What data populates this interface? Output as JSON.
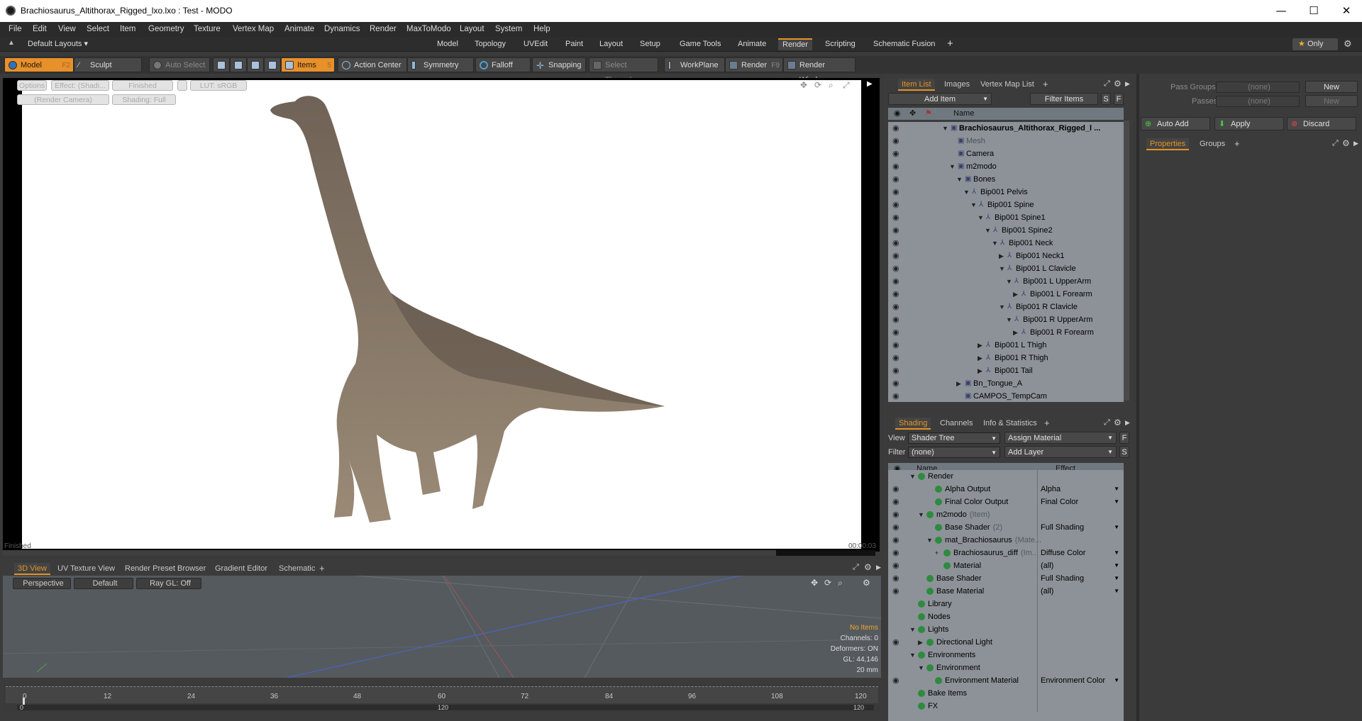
{
  "window": {
    "title": "Brachiosaurus_Altithorax_Rigged_lxo.lxo : Test - MODO",
    "minimize": "—",
    "maximize": "☐",
    "close": "✕"
  },
  "menu": [
    "File",
    "Edit",
    "View",
    "Select",
    "Item",
    "Geometry",
    "Texture",
    "Vertex Map",
    "Animate",
    "Dynamics",
    "Render",
    "MaxToModo",
    "Layout",
    "System",
    "Help"
  ],
  "layouts": {
    "default_layouts": "Default Layouts",
    "tabs": [
      "Model",
      "Topology",
      "UVEdit",
      "Paint",
      "Layout",
      "Setup",
      "Game Tools",
      "Animate",
      "Render",
      "Scripting",
      "Schematic Fusion"
    ],
    "active_tab": "Render",
    "add": "+",
    "only": "Only"
  },
  "toolbar": {
    "model": "Model",
    "model_key": "F2",
    "sculpt": "Sculpt",
    "auto_select": "Auto Select",
    "items": "Items",
    "items_key": "5",
    "action_center": "Action Center",
    "symmetry": "Symmetry",
    "falloff": "Falloff",
    "snapping": "Snapping",
    "select_through": "Select Through",
    "workplane": "WorkPlane",
    "render": "Render",
    "render_key": "F9",
    "render_window": "Render Window"
  },
  "viewport": {
    "options": "Options",
    "effect": "Effect: (Shadi...",
    "finished": "Finished",
    "lut": "LUT: sRGB",
    "camera": "(Render Camera)",
    "shading": "Shading: Full",
    "status_left": "Finished",
    "status_right": "00:00:03"
  },
  "bottom_tabs": [
    "3D View",
    "UV Texture View",
    "Render Preset Browser",
    "Gradient Editor",
    "Schematic"
  ],
  "view3d": {
    "perspective": "Perspective",
    "default": "Default",
    "raygl": "Ray GL: Off",
    "info": [
      "No Items",
      "Channels: 0",
      "Deformers: ON",
      "GL: 44,146",
      "20 mm"
    ]
  },
  "timeline": {
    "ticks": [
      "0",
      "12",
      "24",
      "36",
      "48",
      "60",
      "72",
      "84",
      "96",
      "108",
      "120"
    ],
    "lower_left": "0",
    "lower_mid": "120",
    "lower_right": "120"
  },
  "item_list": {
    "tabs": [
      "Item List",
      "Images",
      "Vertex Map List"
    ],
    "add_item": "Add Item",
    "filter_items": "Filter Items",
    "s": "S",
    "f": "F",
    "name_col": "Name",
    "rows": [
      {
        "label": "Brachiosaurus_Altithorax_Rigged_l ...",
        "depth": 0,
        "exp": "▼",
        "bold": true
      },
      {
        "label": "Mesh",
        "depth": 1,
        "exp": "",
        "dim": true
      },
      {
        "label": "Camera",
        "depth": 1,
        "exp": ""
      },
      {
        "label": "m2modo",
        "depth": 1,
        "exp": "▼"
      },
      {
        "label": "Bones",
        "depth": 2,
        "exp": "▼"
      },
      {
        "label": "Bip001 Pelvis",
        "depth": 3,
        "exp": "▼"
      },
      {
        "label": "Bip001 Spine",
        "depth": 4,
        "exp": "▼"
      },
      {
        "label": "Bip001 Spine1",
        "depth": 5,
        "exp": "▼"
      },
      {
        "label": "Bip001 Spine2",
        "depth": 6,
        "exp": "▼"
      },
      {
        "label": "Bip001 Neck",
        "depth": 7,
        "exp": "▼"
      },
      {
        "label": "Bip001 Neck1",
        "depth": 8,
        "exp": "▶"
      },
      {
        "label": "Bip001 L Clavicle",
        "depth": 8,
        "exp": "▼"
      },
      {
        "label": "Bip001 L UpperArm",
        "depth": 9,
        "exp": "▼"
      },
      {
        "label": "Bip001 L Forearm",
        "depth": 10,
        "exp": "▶"
      },
      {
        "label": "Bip001 R Clavicle",
        "depth": 8,
        "exp": "▼"
      },
      {
        "label": "Bip001 R UpperArm",
        "depth": 9,
        "exp": "▼"
      },
      {
        "label": "Bip001 R Forearm",
        "depth": 10,
        "exp": "▶"
      },
      {
        "label": "Bip001 L Thigh",
        "depth": 5,
        "exp": "▶"
      },
      {
        "label": "Bip001 R Thigh",
        "depth": 5,
        "exp": "▶"
      },
      {
        "label": "Bip001 Tail",
        "depth": 5,
        "exp": "▶"
      },
      {
        "label": "Bn_Tongue_A",
        "depth": 2,
        "exp": "▶"
      },
      {
        "label": "CAMPOS_TempCam",
        "depth": 2,
        "exp": ""
      }
    ]
  },
  "shading": {
    "tabs": [
      "Shading",
      "Channels",
      "Info & Statistics"
    ],
    "view_label": "View",
    "view_value": "Shader Tree",
    "assign_material": "Assign Material",
    "f": "F",
    "filter_label": "Filter",
    "filter_value": "(none)",
    "add_layer": "Add Layer",
    "s": "S",
    "name_col": "Name",
    "effect_col": "Effect",
    "rows": [
      {
        "label": "Render",
        "depth": 0,
        "effect": "",
        "eye": false,
        "exp": "▼"
      },
      {
        "label": "Alpha Output",
        "depth": 2,
        "effect": "Alpha",
        "eye": true,
        "exp": ""
      },
      {
        "label": "Final Color Output",
        "depth": 2,
        "effect": "Final Color",
        "eye": true,
        "exp": ""
      },
      {
        "label": "m2modo",
        "depth": 1,
        "suffix": "(Item)",
        "effect": "",
        "eye": true,
        "exp": "▼"
      },
      {
        "label": "Base Shader",
        "depth": 2,
        "suffix": "(2)",
        "effect": "Full Shading",
        "eye": true,
        "exp": ""
      },
      {
        "label": "mat_Brachiosaurus",
        "depth": 2,
        "suffix": "(Mate...",
        "effect": "",
        "eye": true,
        "exp": "▼"
      },
      {
        "label": "Brachiosaurus_diff",
        "depth": 3,
        "suffix": "(Im...",
        "effect": "Diffuse Color",
        "eye": true,
        "exp": "+"
      },
      {
        "label": "Material",
        "depth": 3,
        "effect": "(all)",
        "eye": true,
        "exp": ""
      },
      {
        "label": "Base Shader",
        "depth": 1,
        "effect": "Full Shading",
        "eye": true,
        "exp": ""
      },
      {
        "label": "Base Material",
        "depth": 1,
        "effect": "(all)",
        "eye": true,
        "exp": ""
      },
      {
        "label": "Library",
        "depth": 0,
        "effect": "",
        "eye": false,
        "exp": ""
      },
      {
        "label": "Nodes",
        "depth": 0,
        "effect": "",
        "eye": false,
        "exp": ""
      },
      {
        "label": "Lights",
        "depth": 0,
        "effect": "",
        "eye": false,
        "exp": "▼"
      },
      {
        "label": "Directional Light",
        "depth": 1,
        "effect": "",
        "eye": true,
        "exp": "▶"
      },
      {
        "label": "Environments",
        "depth": 0,
        "effect": "",
        "eye": false,
        "exp": "▼"
      },
      {
        "label": "Environment",
        "depth": 1,
        "effect": "",
        "eye": false,
        "exp": "▼"
      },
      {
        "label": "Environment Material",
        "depth": 2,
        "effect": "Environment Color",
        "eye": true,
        "exp": ""
      },
      {
        "label": "Bake Items",
        "depth": 0,
        "effect": "",
        "eye": false,
        "exp": ""
      },
      {
        "label": "FX",
        "depth": 0,
        "effect": "",
        "eye": false,
        "exp": ""
      }
    ]
  },
  "passes": {
    "pass_groups": "Pass Groups",
    "passes": "Passes",
    "none": "(none)",
    "new": "New",
    "auto_add": "Auto Add",
    "apply": "Apply",
    "discard": "Discard",
    "tabs": [
      "Properties",
      "Groups"
    ]
  }
}
